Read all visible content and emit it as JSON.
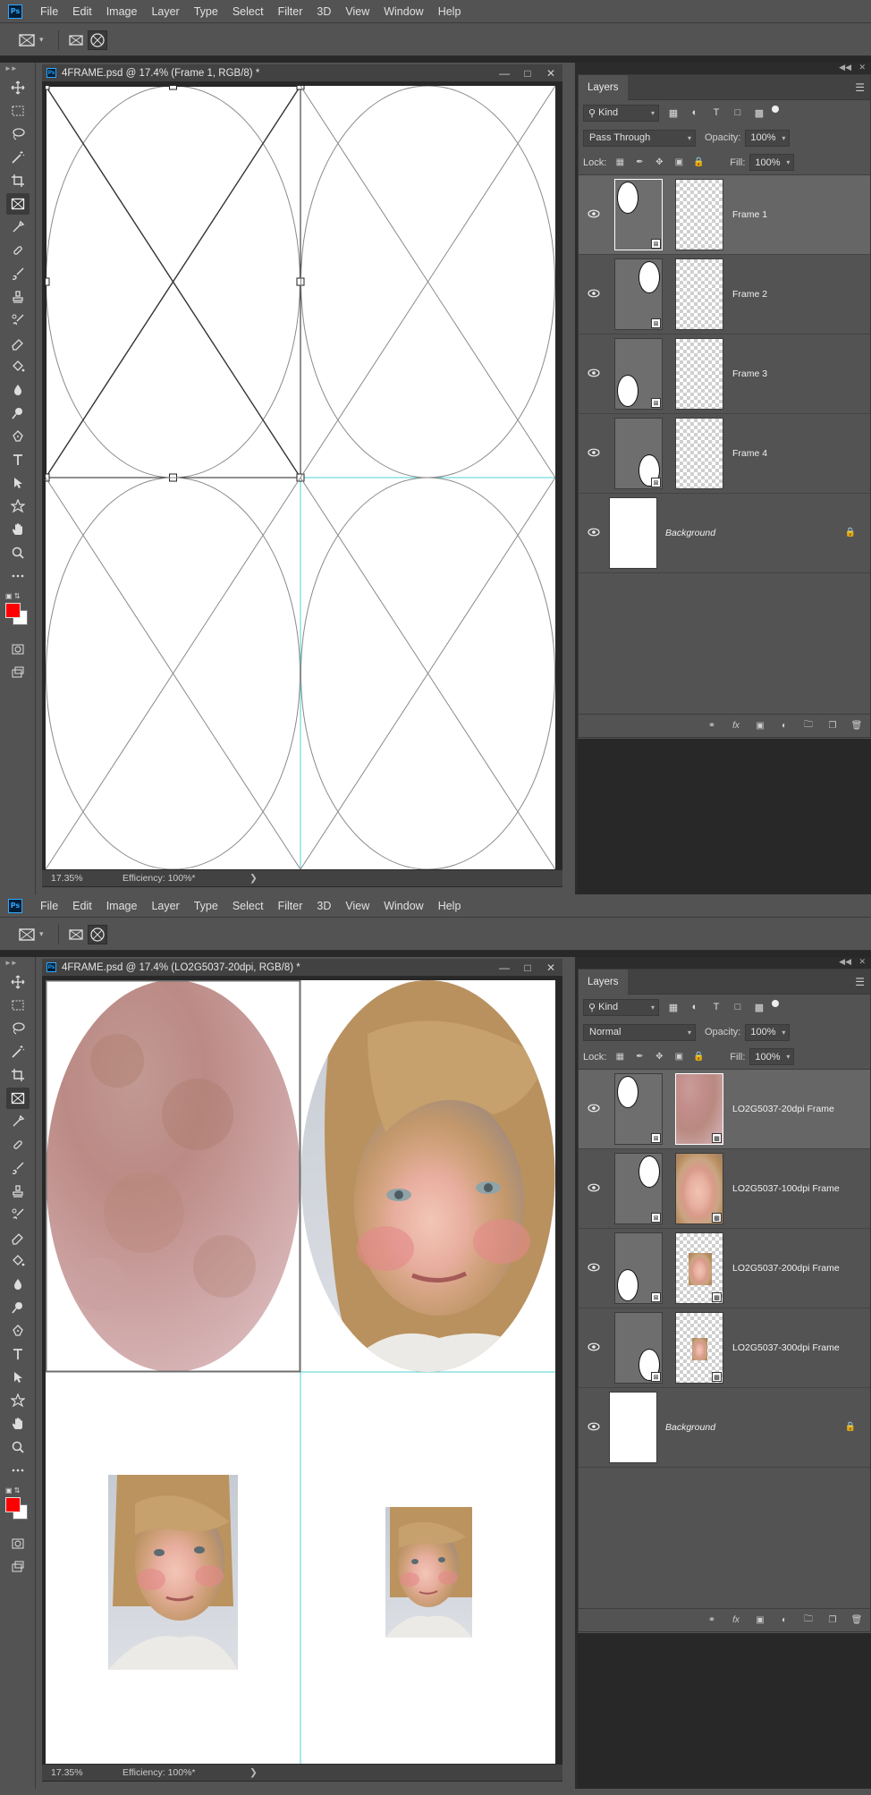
{
  "menu": [
    "File",
    "Edit",
    "Image",
    "Layer",
    "Type",
    "Select",
    "Filter",
    "3D",
    "View",
    "Window",
    "Help"
  ],
  "app_logo": "Ps",
  "tools": [
    "move-icon",
    "marquee-icon",
    "lasso-icon",
    "magic-wand-icon",
    "crop-icon",
    "frame-icon",
    "eyedropper-icon",
    "healing-icon",
    "brush-icon",
    "stamp-icon",
    "history-brush-icon",
    "eraser-icon",
    "bucket-icon",
    "blur-icon",
    "dodge-icon",
    "pen-icon",
    "type-icon",
    "path-select-icon",
    "shape-icon",
    "hand-icon",
    "zoom-icon",
    "more-icon"
  ],
  "colors": {
    "foreground": "#ff0000",
    "background": "#ffffff",
    "guide": "#4fd0d6",
    "selected_layer": "#666666"
  },
  "shot1": {
    "doc_title": "4FRAME.psd @ 17.4% (Frame 1, RGB/8) *",
    "zoom": "17.35%",
    "efficiency": "Efficiency: 100%*",
    "panel_tab": "Layers",
    "kind": "Kind",
    "blend_mode": "Pass Through",
    "opacity_label": "Opacity:",
    "opacity": "100%",
    "lock_label": "Lock:",
    "fill_label": "Fill:",
    "fill": "100%",
    "layers": [
      {
        "name": "Frame 1",
        "selected": true
      },
      {
        "name": "Frame 2",
        "selected": false
      },
      {
        "name": "Frame 3",
        "selected": false
      },
      {
        "name": "Frame 4",
        "selected": false
      }
    ],
    "background_layer": "Background"
  },
  "shot2": {
    "doc_title": "4FRAME.psd @ 17.4% (LO2G5037-20dpi, RGB/8) *",
    "zoom": "17.35%",
    "efficiency": "Efficiency: 100%*",
    "panel_tab": "Layers",
    "kind": "Kind",
    "blend_mode": "Normal",
    "opacity_label": "Opacity:",
    "opacity": "100%",
    "lock_label": "Lock:",
    "fill_label": "Fill:",
    "fill": "100%",
    "layers": [
      {
        "name": "LO2G5037-20dpi Frame",
        "selected": true
      },
      {
        "name": "LO2G5037-100dpi Frame",
        "selected": false
      },
      {
        "name": "LO2G5037-200dpi Frame",
        "selected": false
      },
      {
        "name": "LO2G5037-300dpi Frame",
        "selected": false
      }
    ],
    "background_layer": "Background"
  }
}
